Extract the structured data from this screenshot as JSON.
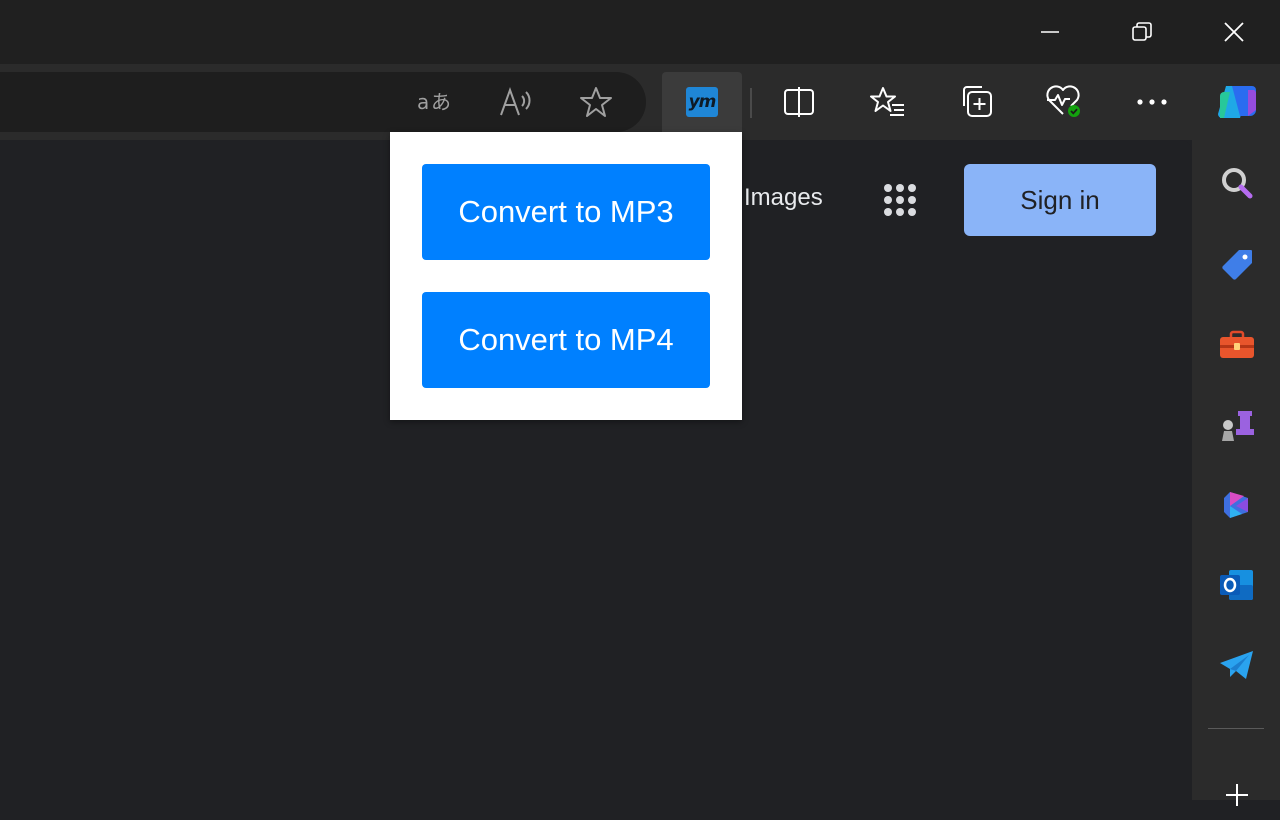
{
  "window_controls": {
    "icons": [
      "minimize-icon",
      "restore-icon",
      "close-icon"
    ]
  },
  "toolbar": {
    "icons": [
      "translate-icon",
      "read-aloud-icon",
      "favorite-star-icon",
      "ym-extension-icon",
      "split-screen-icon",
      "favorites-list-icon",
      "collections-icon",
      "browser-essentials-icon",
      "more-options-icon",
      "copilot-icon"
    ],
    "extension_logo_text": "ym"
  },
  "page": {
    "images_link": "Images",
    "sign_in": "Sign in"
  },
  "popup": {
    "mp3_button": "Convert to MP3",
    "mp4_button": "Convert to MP4",
    "button_color": "#0080ff"
  },
  "sidebar": {
    "icons": [
      "search-icon",
      "shopping-tag-icon",
      "tools-icon",
      "games-icon",
      "microsoft365-icon",
      "outlook-icon",
      "telegram-icon",
      "add-icon"
    ]
  },
  "colors": {
    "signin_bg": "#8ab4f8",
    "page_bg": "#202124"
  }
}
